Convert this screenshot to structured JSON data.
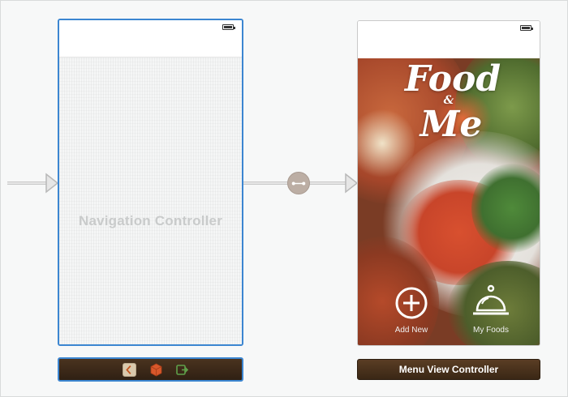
{
  "storyboard": {
    "navigation_controller": {
      "title": "Navigation Controller",
      "dock_icons": [
        "navigation-controller-icon",
        "first-responder-icon",
        "exit-icon"
      ]
    },
    "segue": {
      "icon": "segue-link-icon"
    },
    "menu_view_controller": {
      "title": "Menu View Controller",
      "logo": {
        "line1": "Food",
        "line2": "&",
        "line3": "Me"
      },
      "buttons": [
        {
          "label": "Add New",
          "icon": "plus-circle-icon"
        },
        {
          "label": "My Foods",
          "icon": "serving-dish-icon"
        }
      ]
    }
  },
  "colors": {
    "selection_blue": "#3c86d1",
    "dock_brown": "#4a331f",
    "segue_badge": "#bcaea4"
  }
}
